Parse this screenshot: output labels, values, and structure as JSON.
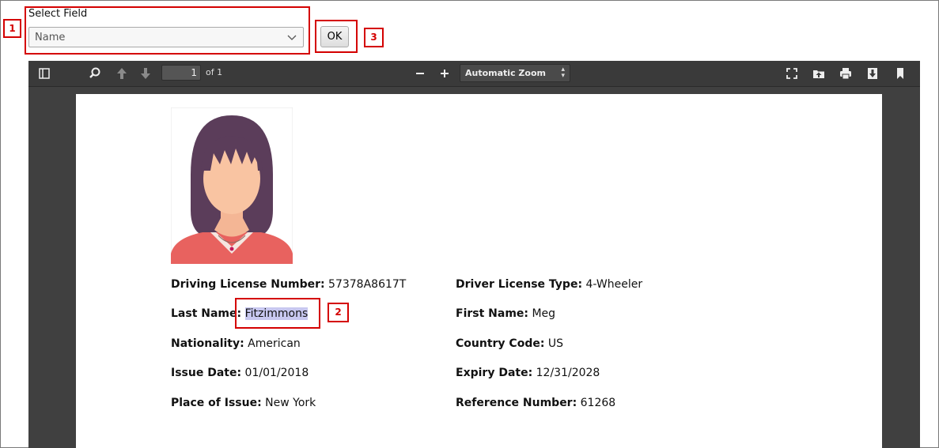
{
  "form": {
    "select_label": "Select Field",
    "select_value": "Name",
    "ok_label": "OK"
  },
  "annotations": [
    "1",
    "2",
    "3"
  ],
  "viewer": {
    "page_current": "1",
    "page_total": "of 1",
    "zoom": "Automatic Zoom"
  },
  "document": {
    "fields": [
      {
        "key": "Driving License Number:",
        "value": "57378A8617T"
      },
      {
        "key": "Driver License Type:",
        "value": "4-Wheeler"
      },
      {
        "key": "Last Name:",
        "value": "Fitzimmons"
      },
      {
        "key": "First Name:",
        "value": "Meg"
      },
      {
        "key": "Nationality:",
        "value": "American"
      },
      {
        "key": "Country Code:",
        "value": "US"
      },
      {
        "key": "Issue Date:",
        "value": "01/01/2018"
      },
      {
        "key": "Expiry Date:",
        "value": "12/31/2028"
      },
      {
        "key": "Place of Issue:",
        "value": "New York"
      },
      {
        "key": "Reference Number:",
        "value": "61268"
      }
    ]
  },
  "colors": {
    "annotation": "#d40000",
    "highlight": "#c8c8f0",
    "toolbar": "#3a3a3a"
  },
  "icons": [
    "sidebar-toggle-icon",
    "search-icon",
    "previous-page-icon",
    "next-page-icon",
    "zoom-out-icon",
    "zoom-in-icon",
    "presentation-mode-icon",
    "open-file-icon",
    "print-icon",
    "download-icon",
    "bookmark-icon",
    "chevron-down-icon"
  ]
}
